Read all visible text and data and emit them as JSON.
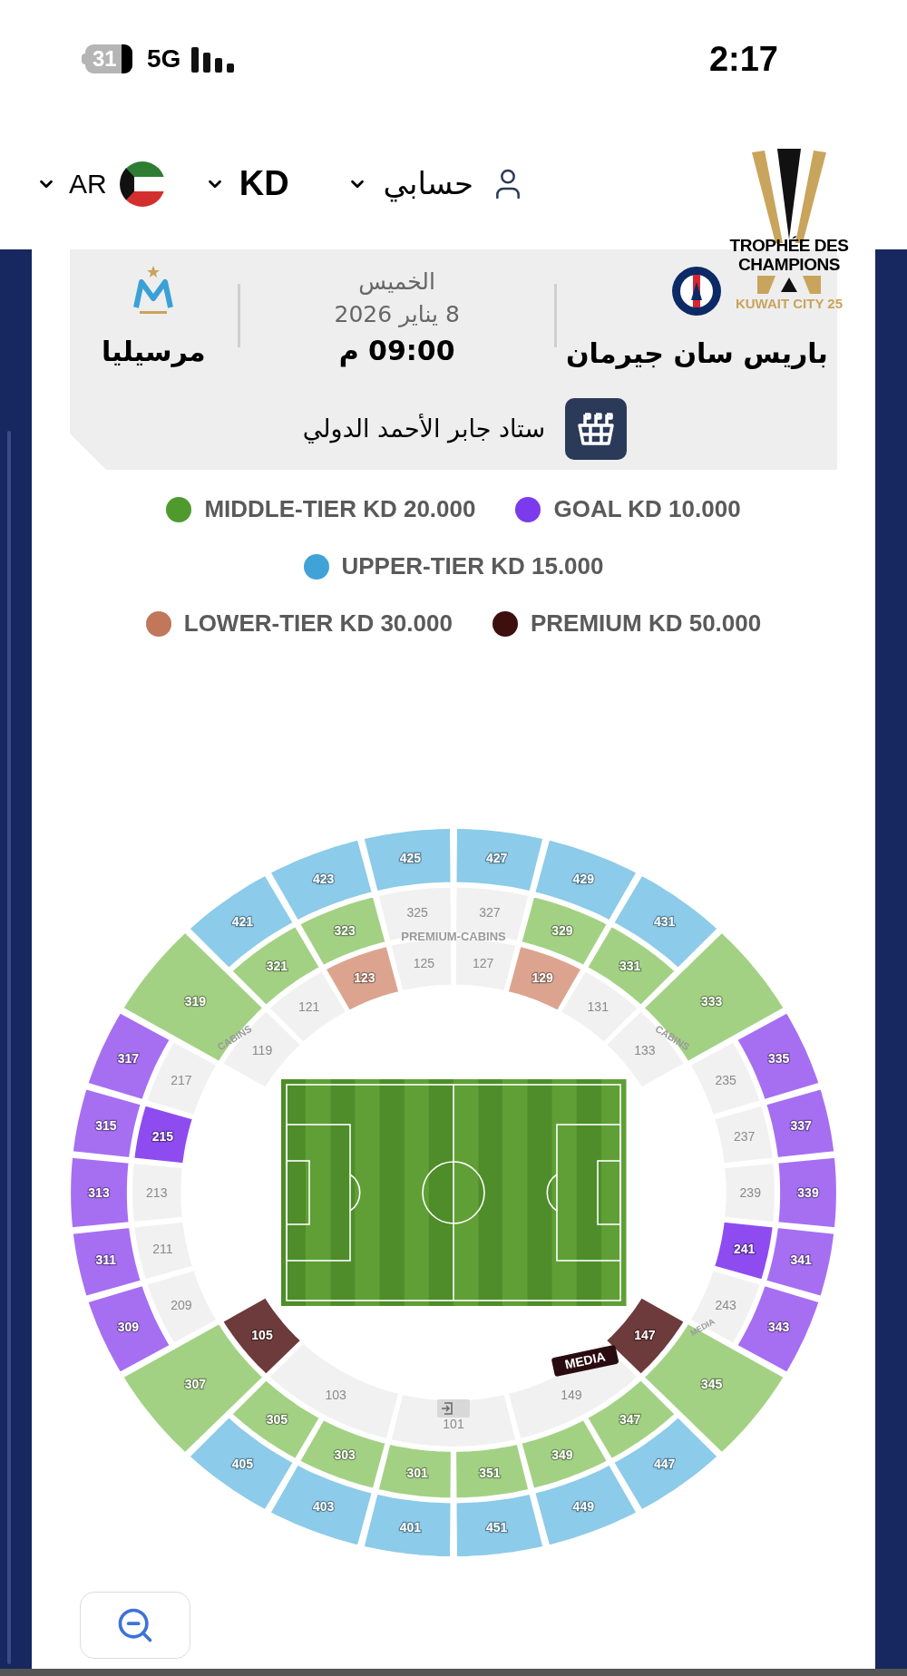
{
  "status_bar": {
    "battery": "31",
    "network": "5G",
    "time": "2:17"
  },
  "nav": {
    "language": "AR",
    "currency": "KD",
    "account": "حسابي"
  },
  "logo": {
    "line_1": "TROPHÉE DES",
    "line_2": "CHAMPIONS",
    "line_3": "KUWAIT CITY 25"
  },
  "match": {
    "home_team": "باريس سان جيرمان",
    "day": "الخميس",
    "date": "8 يناير 2026",
    "time": "09:00 م",
    "away_team": "مرسيليا",
    "venue": "ستاد جابر الأحمد الدولي"
  },
  "legend_rows": [
    {
      "items": [
        {
          "label": "MIDDLE-TIER KD 20.000",
          "color": "#4f9a2d"
        },
        {
          "label": "GOAL KD 10.000",
          "color": "#7c3aed"
        }
      ]
    },
    {
      "items": [
        {
          "label": "UPPER-TIER KD 15.000",
          "color": "#3fa3d8"
        }
      ]
    },
    {
      "items": [
        {
          "label": "LOWER-TIER KD 30.000",
          "color": "#c0775a"
        },
        {
          "label": "PREMIUM KD 50.000",
          "color": "#3d0f0f"
        }
      ]
    }
  ],
  "stadium": {
    "map_labels": [
      "PREMIUM-CABINS",
      "CABINS",
      "CABINS",
      "MEDIA"
    ],
    "media_badge": "MEDIA",
    "sections": [
      {
        "label": "421",
        "color": "#8ccbe9",
        "available": true
      },
      {
        "label": "423",
        "color": "#8ccbe9",
        "available": true
      },
      {
        "label": "425",
        "color": "#8ccbe9",
        "available": true
      },
      {
        "label": "427",
        "color": "#8ccbe9",
        "available": true
      },
      {
        "label": "429",
        "color": "#8ccbe9",
        "available": true
      },
      {
        "label": "431",
        "color": "#8ccbe9",
        "available": true
      },
      {
        "label": "321",
        "color": "#a3d184",
        "available": true
      },
      {
        "label": "323",
        "color": "#a3d184",
        "available": true
      },
      {
        "label": "325",
        "color": "#f1f1f1",
        "available": false
      },
      {
        "label": "327",
        "color": "#f1f1f1",
        "available": false
      },
      {
        "label": "329",
        "color": "#a3d184",
        "available": true
      },
      {
        "label": "331",
        "color": "#a3d184",
        "available": true
      },
      {
        "label": "319",
        "color": "#a3d184",
        "available": true
      },
      {
        "label": "333",
        "color": "#a3d184",
        "available": true
      },
      {
        "label": "119",
        "color": "#f1f1f1",
        "available": false
      },
      {
        "label": "121",
        "color": "#f1f1f1",
        "available": false
      },
      {
        "label": "123",
        "color": "#dca48f",
        "available": true
      },
      {
        "label": "125",
        "color": "#f1f1f1",
        "available": false
      },
      {
        "label": "127",
        "color": "#f1f1f1",
        "available": false
      },
      {
        "label": "129",
        "color": "#dca48f",
        "available": true
      },
      {
        "label": "131",
        "color": "#f1f1f1",
        "available": false
      },
      {
        "label": "133",
        "color": "#f1f1f1",
        "available": false
      },
      {
        "label": "317",
        "color": "#a66ff2",
        "available": true
      },
      {
        "label": "315",
        "color": "#a66ff2",
        "available": true
      },
      {
        "label": "313",
        "color": "#a66ff2",
        "available": true
      },
      {
        "label": "311",
        "color": "#a66ff2",
        "available": true
      },
      {
        "label": "309",
        "color": "#a66ff2",
        "available": true
      },
      {
        "label": "217",
        "color": "#f1f1f1",
        "available": false
      },
      {
        "label": "215",
        "color": "#8e4cf0",
        "available": true
      },
      {
        "label": "213",
        "color": "#f1f1f1",
        "available": false
      },
      {
        "label": "211",
        "color": "#f1f1f1",
        "available": false
      },
      {
        "label": "209",
        "color": "#f1f1f1",
        "available": false
      },
      {
        "label": "335",
        "color": "#a66ff2",
        "available": true
      },
      {
        "label": "337",
        "color": "#a66ff2",
        "available": true
      },
      {
        "label": "339",
        "color": "#a66ff2",
        "available": true
      },
      {
        "label": "341",
        "color": "#a66ff2",
        "available": true
      },
      {
        "label": "343",
        "color": "#a66ff2",
        "available": true
      },
      {
        "label": "235",
        "color": "#f1f1f1",
        "available": false
      },
      {
        "label": "237",
        "color": "#f1f1f1",
        "available": false
      },
      {
        "label": "239",
        "color": "#f1f1f1",
        "available": false
      },
      {
        "label": "241",
        "color": "#8e4cf0",
        "available": true
      },
      {
        "label": "243",
        "color": "#f1f1f1",
        "available": false
      },
      {
        "label": "307",
        "color": "#a3d184",
        "available": true
      },
      {
        "label": "345",
        "color": "#a3d184",
        "available": true
      },
      {
        "label": "305",
        "color": "#a3d184",
        "available": true
      },
      {
        "label": "303",
        "color": "#a3d184",
        "available": true
      },
      {
        "label": "301",
        "color": "#a3d184",
        "available": true
      },
      {
        "label": "351",
        "color": "#a3d184",
        "available": true
      },
      {
        "label": "349",
        "color": "#a3d184",
        "available": true
      },
      {
        "label": "347",
        "color": "#a3d184",
        "available": true
      },
      {
        "label": "405",
        "color": "#8ccbe9",
        "available": true
      },
      {
        "label": "403",
        "color": "#8ccbe9",
        "available": true
      },
      {
        "label": "401",
        "color": "#8ccbe9",
        "available": true
      },
      {
        "label": "451",
        "color": "#8ccbe9",
        "available": true
      },
      {
        "label": "449",
        "color": "#8ccbe9",
        "available": true
      },
      {
        "label": "447",
        "color": "#8ccbe9",
        "available": true
      },
      {
        "label": "105",
        "color": "#6d3b3b",
        "available": true
      },
      {
        "label": "103",
        "color": "#f1f1f1",
        "available": false
      },
      {
        "label": "101",
        "color": "#f1f1f1",
        "available": false
      },
      {
        "label": "149",
        "color": "#f1f1f1",
        "available": false
      },
      {
        "label": "147",
        "color": "#6d3b3b",
        "available": true
      }
    ]
  }
}
